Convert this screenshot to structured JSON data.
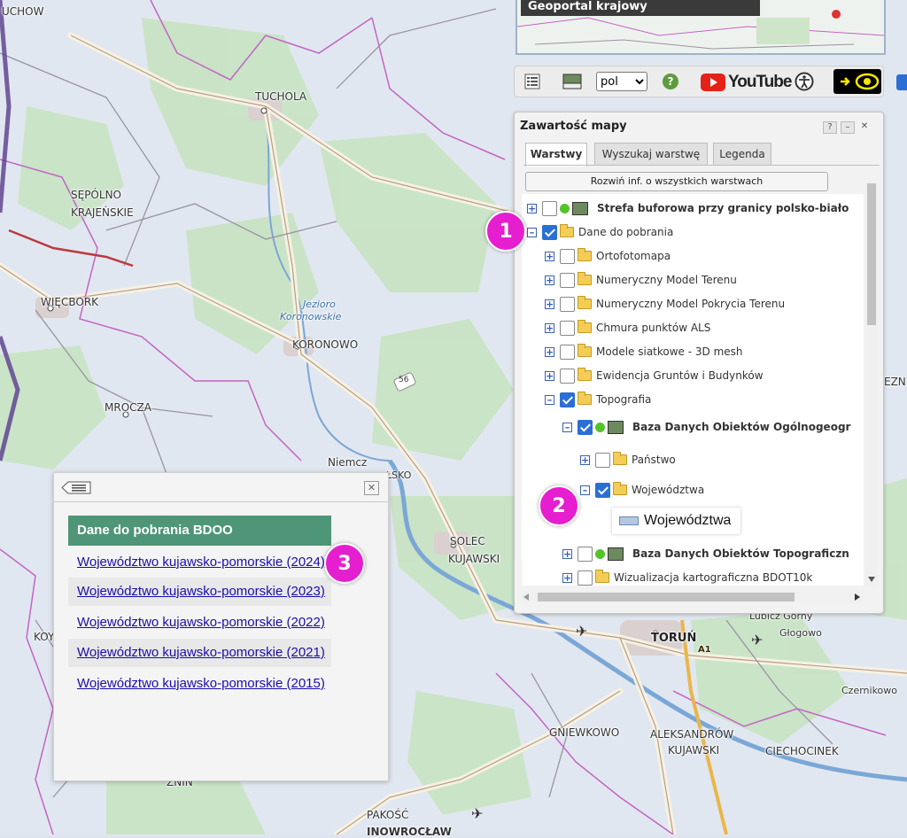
{
  "map": {
    "places": [
      {
        "name": "UCHOW",
        "size": "normal"
      },
      {
        "name": "TUCHOLA",
        "size": "normal"
      },
      {
        "name": "SĘPÓLNO",
        "size": "normal"
      },
      {
        "name": "KRAJEŃSKIE",
        "size": "normal"
      },
      {
        "name": "WIĘCBORK",
        "size": "normal"
      },
      {
        "name": "KORONOWO",
        "size": "normal"
      },
      {
        "name": "MROCZA",
        "size": "normal"
      },
      {
        "name": "SOLEC",
        "size": "normal"
      },
      {
        "name": "KUJAWSKI",
        "size": "normal"
      },
      {
        "name": "TORUŃ",
        "size": "big"
      },
      {
        "name": "GNIEWKOWO",
        "size": "normal"
      },
      {
        "name": "ALEKSANDRÓW",
        "size": "normal"
      },
      {
        "name": "KUJAWSKI",
        "size": "normal"
      },
      {
        "name": "CIECHOCINEK",
        "size": "normal"
      },
      {
        "name": "Głogowo",
        "size": "normal"
      },
      {
        "name": "Lubicz Górny",
        "size": "normal"
      },
      {
        "name": "Czernikowo",
        "size": "normal"
      },
      {
        "name": "PAKOŚĆ",
        "size": "normal"
      },
      {
        "name": "INOWROCŁAW",
        "size": "normal"
      },
      {
        "name": "ŻNIN",
        "size": "normal"
      },
      {
        "name": "Niemcz",
        "size": "normal"
      },
      {
        "name": "ŁSKO",
        "size": "normal"
      },
      {
        "name": "EZN",
        "size": "normal"
      },
      {
        "name": "KOY",
        "size": "normal"
      }
    ],
    "water_labels": [
      "Jezioro",
      "Koronowskie"
    ],
    "road_numbers": [
      "56",
      "A1"
    ]
  },
  "geoportal_thumb": {
    "title": "Geoportal krajowy"
  },
  "toolbar": {
    "lang_value": "pol",
    "lang_options": [
      "pol"
    ],
    "youtube_label": "YouTube",
    "icons": [
      "legend-list-icon",
      "wms-icon",
      "help-icon",
      "youtube-icon",
      "accessibility-icon",
      "contrast-eye-icon"
    ]
  },
  "panel": {
    "title": "Zawartość mapy",
    "buttons": {
      "help": "?",
      "minimize": "–",
      "close": "✕"
    },
    "tabs": [
      "Warstwy",
      "Wyszukaj warstwę",
      "Legenda"
    ],
    "active_tab": "Warstwy",
    "expand_button": "Rozwiń inf. o wszystkich warstwach",
    "tree": [
      {
        "label": "Strefa buforowa przy granicy polsko-biało",
        "expander": "+",
        "checked": false,
        "type": "wms",
        "bold": true
      },
      {
        "label": "Dane do pobrania",
        "expander": "–",
        "checked": true,
        "type": "folder",
        "bold": false
      },
      {
        "label": "Ortofotomapa",
        "expander": "+",
        "checked": false,
        "type": "folder",
        "bold": false
      },
      {
        "label": "Numeryczny Model Terenu",
        "expander": "+",
        "checked": false,
        "type": "folder",
        "bold": false
      },
      {
        "label": "Numeryczny Model Pokrycia Terenu",
        "expander": "+",
        "checked": false,
        "type": "folder",
        "bold": false
      },
      {
        "label": "Chmura punktów ALS",
        "expander": "+",
        "checked": false,
        "type": "folder",
        "bold": false
      },
      {
        "label": "Modele siatkowe - 3D mesh",
        "expander": "+",
        "checked": false,
        "type": "folder",
        "bold": false
      },
      {
        "label": "Ewidencja Gruntów i Budynków",
        "expander": "+",
        "checked": false,
        "type": "folder",
        "bold": false
      },
      {
        "label": "Topografia",
        "expander": "–",
        "checked": true,
        "type": "folder",
        "bold": false
      },
      {
        "label": "Baza Danych Obiektów Ogólnogeogr",
        "expander": "–",
        "checked": true,
        "type": "wms",
        "bold": true
      },
      {
        "label": "Państwo",
        "expander": "+",
        "checked": false,
        "type": "folder",
        "bold": false
      },
      {
        "label": "Województwa",
        "expander": "–",
        "checked": true,
        "type": "folder",
        "bold": false
      },
      {
        "label": "Baza Danych Obiektów Topograficzn",
        "expander": "+",
        "checked": false,
        "type": "wms",
        "bold": true
      },
      {
        "label": "Wizualizacja kartograficzna BDOT10k",
        "expander": "+",
        "checked": false,
        "type": "folder",
        "bold": false
      }
    ],
    "legend_label": "Województwa"
  },
  "markers": [
    "1",
    "2",
    "3"
  ],
  "popup": {
    "close": "✕",
    "header": "Dane do pobrania BDOO",
    "links": [
      "Województwo kujawsko-pomorskie (2024)",
      "Województwo kujawsko-pomorskie (2023)",
      "Województwo kujawsko-pomorskie (2022)",
      "Województwo kujawsko-pomorskie (2021)",
      "Województwo kujawsko-pomorskie (2015)"
    ]
  },
  "colors": {
    "marker": "#e51ecf",
    "popup_header": "#4e9677",
    "link": "#1a0dab",
    "checkbox": "#2a6fd6"
  }
}
